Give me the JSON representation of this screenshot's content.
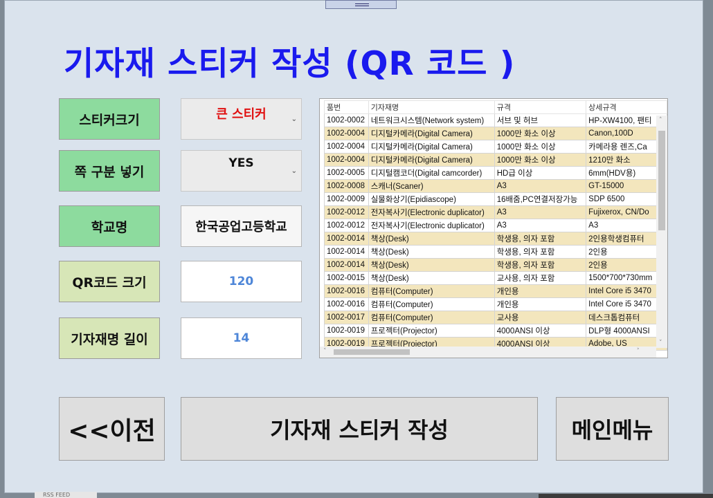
{
  "title": "기자재 스티커 작성 (QR 코드 )",
  "fields": {
    "sticker_size": {
      "label": "스티커크기",
      "value": "큰 스티커"
    },
    "page_division": {
      "label": "쪽 구분 넣기",
      "value": "YES"
    },
    "school_name": {
      "label": "학교명",
      "value": "한국공업고등학교"
    },
    "qr_size": {
      "label": "QR코드 크기",
      "value": "120"
    },
    "name_length": {
      "label": "기자재명 길이",
      "value": "14"
    }
  },
  "colors": {
    "title": "#1a1aee",
    "sticker_value": "#e01010",
    "number_value": "#4e86d8",
    "label_green": "#8ddb9e",
    "label_yellow": "#d7e6b7",
    "row_highlight": "#f3e6bd"
  },
  "table": {
    "columns": [
      "품번",
      "기자재명",
      "규격",
      "상세규격"
    ],
    "rows": [
      {
        "cells": [
          "1002-0002",
          "네트워크시스템(Network system)",
          "서브 및 허브",
          "HP-XW4100, 팬티"
        ],
        "highlight": false
      },
      {
        "cells": [
          "1002-0004",
          "디지털카메라(Digital Camera)",
          "1000만 화소 이상",
          "Canon,100D"
        ],
        "highlight": true
      },
      {
        "cells": [
          "1002-0004",
          "디지털카메라(Digital Camera)",
          "1000만 화소 이상",
          "카메라용 렌즈,Ca"
        ],
        "highlight": false
      },
      {
        "cells": [
          "1002-0004",
          "디지털카메라(Digital Camera)",
          "1000만 화소 이상",
          "1210만 화소"
        ],
        "highlight": true
      },
      {
        "cells": [
          "1002-0005",
          "디지털캠코더(Digital camcorder)",
          "HD급 이상",
          "6mm(HDV용)"
        ],
        "highlight": false
      },
      {
        "cells": [
          "1002-0008",
          "스캐너(Scaner)",
          "A3",
          "GT-15000"
        ],
        "highlight": true
      },
      {
        "cells": [
          "1002-0009",
          "실물화상기(Epidiascope)",
          "16배줌,PC연결저장가능",
          "SDP 6500"
        ],
        "highlight": false
      },
      {
        "cells": [
          "1002-0012",
          "전자복사기(Electronic duplicator)",
          "A3",
          "Fujixerox, CN/Do"
        ],
        "highlight": true
      },
      {
        "cells": [
          "1002-0012",
          "전자복사기(Electronic duplicator)",
          "A3",
          "A3"
        ],
        "highlight": false
      },
      {
        "cells": [
          "1002-0014",
          "책상(Desk)",
          "학생용, 의자 포함",
          "2인용학생컴퓨터"
        ],
        "highlight": true
      },
      {
        "cells": [
          "1002-0014",
          "책상(Desk)",
          "학생용, 의자 포함",
          "2인용"
        ],
        "highlight": false
      },
      {
        "cells": [
          "1002-0014",
          "책상(Desk)",
          "학생용, 의자 포함",
          "2인용"
        ],
        "highlight": true
      },
      {
        "cells": [
          "1002-0015",
          "책상(Desk)",
          "교사용, 의자 포함",
          "1500*700*730mm"
        ],
        "highlight": false
      },
      {
        "cells": [
          "1002-0016",
          "컴퓨터(Computer)",
          "개인용",
          "Intel Core i5 3470"
        ],
        "highlight": true
      },
      {
        "cells": [
          "1002-0016",
          "컴퓨터(Computer)",
          "개인용",
          "Intel Core i5 3470"
        ],
        "highlight": false
      },
      {
        "cells": [
          "1002-0017",
          "컴퓨터(Computer)",
          "교사용",
          "데스크톱컴퓨터"
        ],
        "highlight": true
      },
      {
        "cells": [
          "1002-0019",
          "프로젝터(Projector)",
          "4000ANSI 이상",
          "DLP형 4000ANSI"
        ],
        "highlight": false
      },
      {
        "cells": [
          "1002-0019",
          "프로젝터(Projector)",
          "4000ANSI 이상",
          "Adobe, US"
        ],
        "highlight": true
      }
    ]
  },
  "buttons": {
    "prev": "<<이전",
    "create": "기자재 스티커 작성",
    "main_menu": "메인메뉴"
  },
  "taskbar": {
    "item": "RSS FEED"
  }
}
